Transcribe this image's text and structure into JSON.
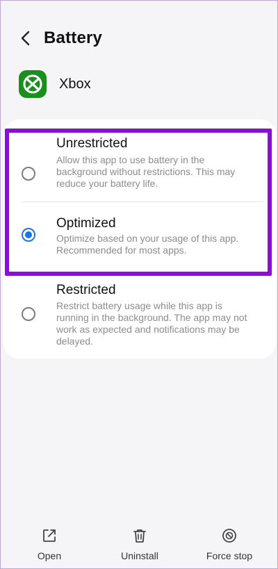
{
  "header": {
    "title": "Battery",
    "back_icon": "back-arrow-icon"
  },
  "app": {
    "name": "Xbox",
    "icon": "xbox-icon",
    "icon_color": "#1a8f1e"
  },
  "options": [
    {
      "title": "Unrestricted",
      "description": "Allow this app to use battery in the background without restrictions. This may reduce your battery life.",
      "selected": false
    },
    {
      "title": "Optimized",
      "description": "Optimize based on your usage of this app. Recommended for most apps.",
      "selected": true
    },
    {
      "title": "Restricted",
      "description": "Restrict battery usage while this app is running in the background. The app may not work as expected and notifications may be delayed.",
      "selected": false
    }
  ],
  "highlight_color": "#8a0fd6",
  "accent_color": "#1a73e8",
  "bottom_bar": [
    {
      "label": "Open",
      "icon": "open-external-icon"
    },
    {
      "label": "Uninstall",
      "icon": "trash-icon"
    },
    {
      "label": "Force stop",
      "icon": "force-stop-icon"
    }
  ]
}
